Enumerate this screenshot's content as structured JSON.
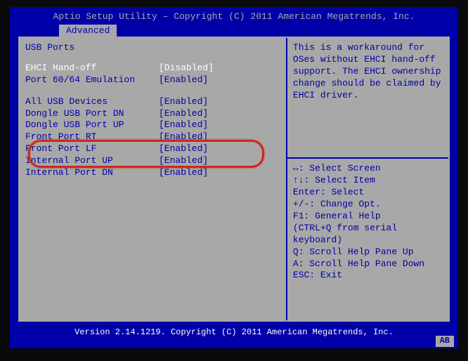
{
  "header": {
    "title": "Aptio Setup Utility – Copyright (C) 2011 American Megatrends, Inc.",
    "tab": "Advanced"
  },
  "section_title": "USB Ports",
  "settings": [
    {
      "label": "EHCI Hand-off",
      "value": "[Disabled]",
      "white": true
    },
    {
      "label": "Port 60/64 Emulation",
      "value": "[Enabled]",
      "white": false
    }
  ],
  "settings2": [
    {
      "label": "All USB Devices",
      "value": "[Enabled]",
      "white": false,
      "highlighted": true
    },
    {
      "label": "Dongle USB Port DN",
      "value": "[Enabled]",
      "white": false
    },
    {
      "label": "Dongle USB Port UP",
      "value": "[Enabled]",
      "white": false
    },
    {
      "label": "Front Port RT",
      "value": "[Enabled]",
      "white": false
    },
    {
      "label": "Front Port LF",
      "value": "[Enabled]",
      "white": false
    },
    {
      "label": "Internal Port UP",
      "value": "[Enabled]",
      "white": false
    },
    {
      "label": "Internal Port DN",
      "value": "[Enabled]",
      "white": false
    }
  ],
  "help": {
    "text": "This is a workaround for OSes without EHCI hand-off support. The EHCI ownership change should be claimed by EHCI driver."
  },
  "keys": [
    "↔: Select Screen",
    "↑↓: Select Item",
    "Enter: Select",
    "+/-: Change Opt.",
    "F1: General Help",
    "(CTRL+Q from serial",
    "keyboard)",
    "Q: Scroll Help Pane Up",
    "A: Scroll Help Pane Down",
    "ESC: Exit"
  ],
  "footer": {
    "version": "Version 2.14.1219. Copyright (C) 2011 American Megatrends, Inc.",
    "badge": "AB"
  }
}
